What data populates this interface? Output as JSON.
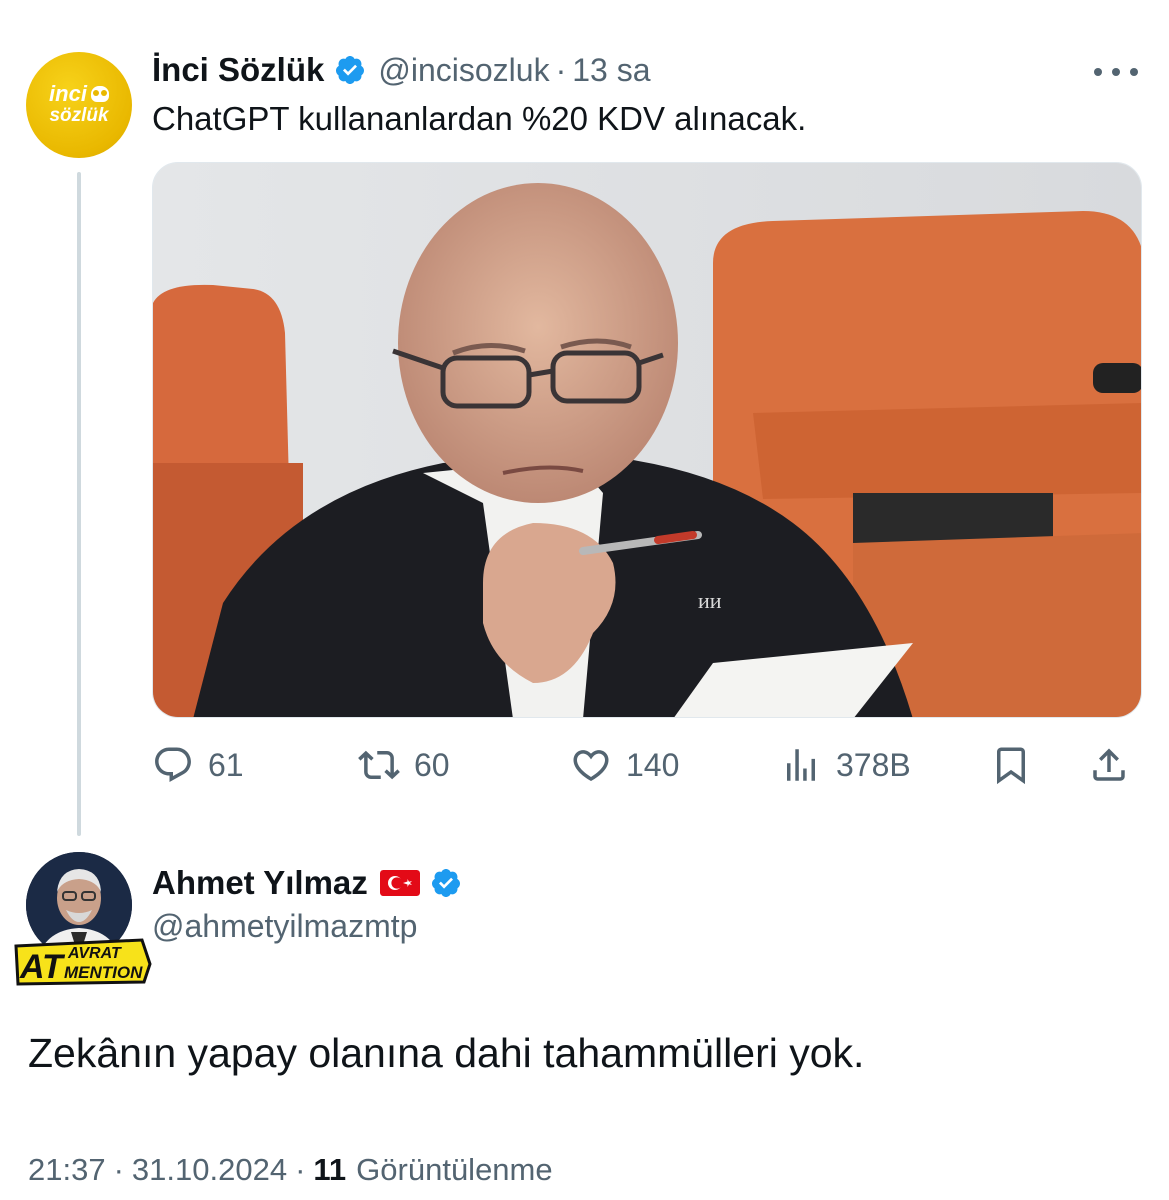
{
  "quoted_tweet": {
    "avatar": {
      "line1": "inci",
      "line2": "sözlük",
      "color": "#e9b800"
    },
    "author_name": "İnci Sözlük",
    "handle": "@incisozluk",
    "separator": "·",
    "time": "13 sa",
    "text": "ChatGPT kullananlardan %20 KDV alınacak.",
    "media_description_icon": "photo",
    "actions": {
      "replies": "61",
      "reposts": "60",
      "likes": "140",
      "views": "378B"
    }
  },
  "main_tweet": {
    "author_name": "Ahmet Yılmaz",
    "handle": "@ahmetyilmazmtp",
    "badge": {
      "top": "AVRAT",
      "big": "AT",
      "bottom": "MENTION"
    },
    "text": "Zekânın yapay olanına dahi tahammülleri yok.",
    "time": "21:37",
    "separator1": "·",
    "date": "31.10.2024",
    "separator2": "·",
    "views_count": "11",
    "views_label": "Görüntülenme"
  },
  "colors": {
    "text_primary": "#0f1419",
    "text_secondary": "#536471",
    "verified_blue": "#1d9bf0",
    "thread_line": "#cfd9de"
  }
}
